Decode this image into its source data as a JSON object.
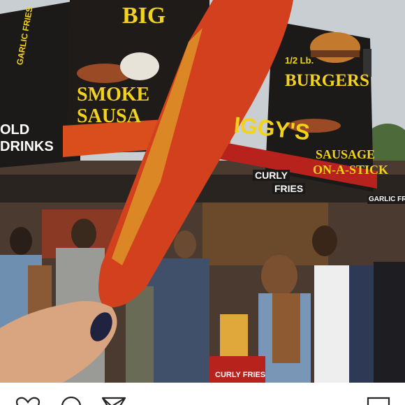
{
  "photo": {
    "signs": {
      "cold_drinks_line1": "OLD",
      "cold_drinks_line2": "DRINKS",
      "big_line": "BIG",
      "smoked_sausage_line1": "SMOKE",
      "smoked_sausage_line2": "SAUSA",
      "garlic_fries_left": "GARLIC FRIES",
      "burgers_small": "1/2 Lb.",
      "burgers": "BURGERS",
      "iggys": "IGGY'S",
      "sausage_on_stick_line1": "SAUSAGE",
      "sausage_on_stick_line2": "ON-A-STICK",
      "curly_fries_line1": "CURLY",
      "curly_fries_line2": "FRIES",
      "garlic_fries_right": "GARLIC FRIES",
      "curly_fries_bottom": "CURLY FRIES"
    },
    "colors": {
      "sky": "#c9ced3",
      "sign_black": "#1c1a18",
      "sign_yellow": "#f3d21b",
      "corn_topping": "#d2401e",
      "awning_red": "#b8221c",
      "nail_polish": "#1f2340"
    }
  },
  "actions": {
    "like_icon": "heart-icon",
    "comment_icon": "comment-icon",
    "share_icon": "send-icon",
    "save_icon": "bookmark-icon"
  }
}
